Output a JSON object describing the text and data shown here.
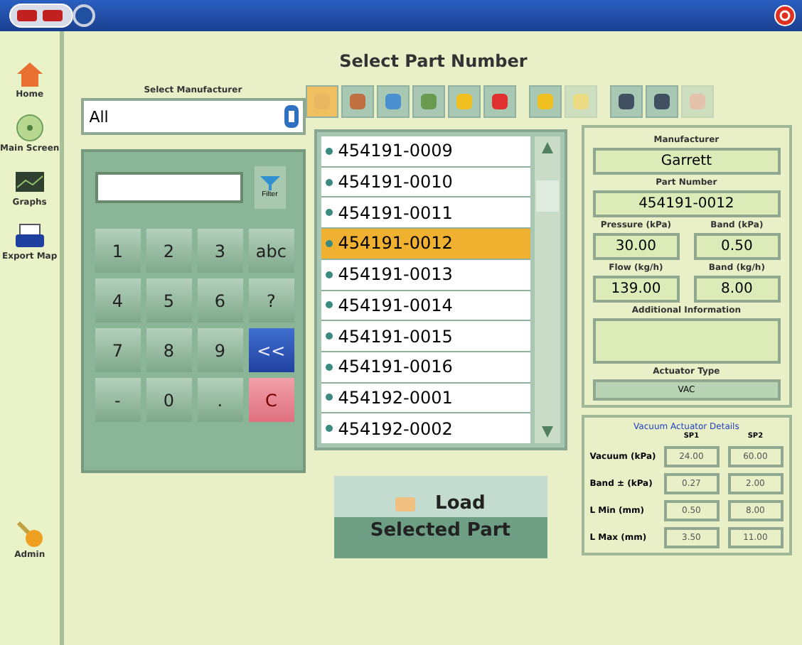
{
  "sidebar": {
    "items": [
      {
        "label": "Home"
      },
      {
        "label": "Main Screen"
      },
      {
        "label": "Graphs"
      },
      {
        "label": "Export Map"
      }
    ],
    "admin": {
      "label": "Admin"
    }
  },
  "title": "Select Part Number",
  "manufacturer": {
    "label": "Select Manufacturer",
    "value": "All"
  },
  "toolbar": [
    {
      "selected": true,
      "disabled": false
    },
    {
      "selected": false,
      "disabled": false
    },
    {
      "selected": false,
      "disabled": false
    },
    {
      "selected": false,
      "disabled": false
    },
    {
      "selected": false,
      "disabled": false
    },
    {
      "selected": false,
      "disabled": false
    },
    {
      "selected": false,
      "disabled": false
    },
    {
      "selected": false,
      "disabled": true
    },
    {
      "selected": false,
      "disabled": false
    },
    {
      "selected": false,
      "disabled": false
    },
    {
      "selected": false,
      "disabled": true
    }
  ],
  "keypad": {
    "filter_label": "Filter",
    "keys": [
      {
        "label": "1",
        "kind": "plain"
      },
      {
        "label": "2",
        "kind": "plain"
      },
      {
        "label": "3",
        "kind": "plain"
      },
      {
        "label": "abc",
        "kind": "plain"
      },
      {
        "label": "4",
        "kind": "plain"
      },
      {
        "label": "5",
        "kind": "plain"
      },
      {
        "label": "6",
        "kind": "plain"
      },
      {
        "label": "?",
        "kind": "plain"
      },
      {
        "label": "7",
        "kind": "plain"
      },
      {
        "label": "8",
        "kind": "plain"
      },
      {
        "label": "9",
        "kind": "plain"
      },
      {
        "label": "<<",
        "kind": "back"
      },
      {
        "label": "-",
        "kind": "plain"
      },
      {
        "label": "0",
        "kind": "plain"
      },
      {
        "label": ".",
        "kind": "plain"
      },
      {
        "label": "C",
        "kind": "clear"
      }
    ]
  },
  "parts": [
    {
      "label": "454191-0009",
      "selected": false
    },
    {
      "label": "454191-0010",
      "selected": false
    },
    {
      "label": "454191-0011",
      "selected": false
    },
    {
      "label": "454191-0012",
      "selected": true
    },
    {
      "label": "454191-0013",
      "selected": false
    },
    {
      "label": "454191-0014",
      "selected": false
    },
    {
      "label": "454191-0015",
      "selected": false
    },
    {
      "label": "454191-0016",
      "selected": false
    },
    {
      "label": "454192-0001",
      "selected": false
    },
    {
      "label": "454192-0002",
      "selected": false
    }
  ],
  "load_button": {
    "line1": "Load",
    "line2": "Selected Part"
  },
  "details": {
    "manufacturer_label": "Manufacturer",
    "manufacturer": "Garrett",
    "part_label": "Part Number",
    "part": "454191-0012",
    "fields": [
      {
        "label": "Pressure (kPa)",
        "value": "30.00"
      },
      {
        "label": "Band (kPa)",
        "value": "0.50"
      },
      {
        "label": "Flow (kg/h)",
        "value": "139.00"
      },
      {
        "label": "Band (kg/h)",
        "value": "8.00"
      }
    ],
    "info_label": "Additional Information",
    "actuator_label": "Actuator Type",
    "actuator": "VAC"
  },
  "vacuum": {
    "title": "Vacuum Actuator Details",
    "columns": [
      "SP1",
      "SP2"
    ],
    "rows": [
      {
        "label": "Vacuum (kPa)",
        "values": [
          "24.00",
          "60.00"
        ]
      },
      {
        "label": "Band ± (kPa)",
        "values": [
          "0.27",
          "2.00"
        ]
      },
      {
        "label": "L Min (mm)",
        "values": [
          "0.50",
          "8.00"
        ]
      },
      {
        "label": "L Max (mm)",
        "values": [
          "3.50",
          "11.00"
        ]
      }
    ]
  }
}
